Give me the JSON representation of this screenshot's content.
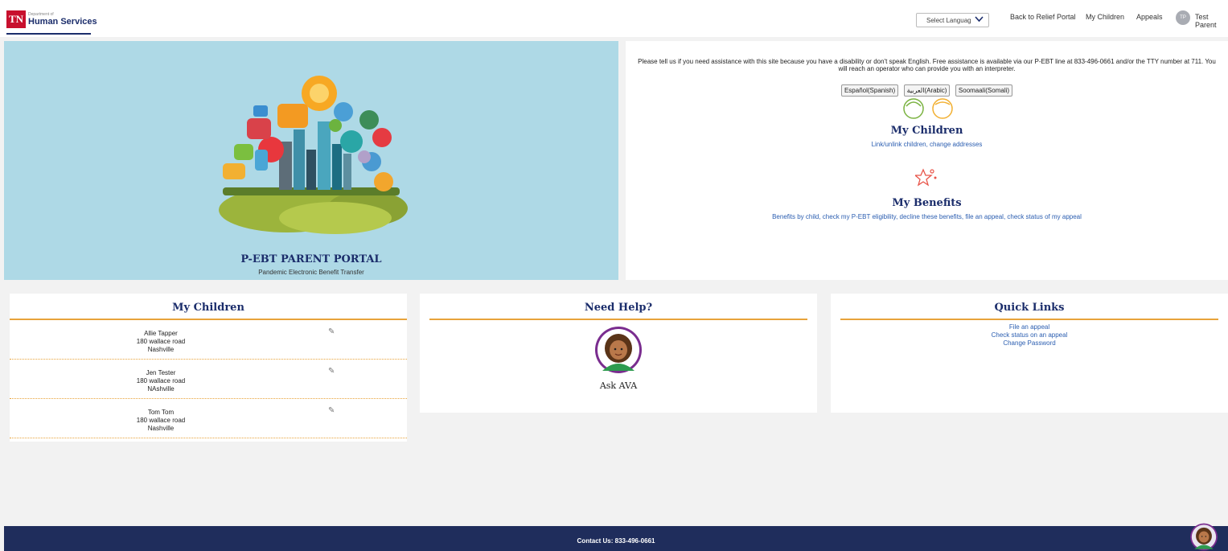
{
  "header": {
    "logo_abbr": "TN",
    "logo_dept": "Department of",
    "logo_name": "Human Services",
    "language_select": "Select Languag",
    "nav": {
      "back": "Back to Relief Portal",
      "children": "My Children",
      "appeals": "Appeals"
    },
    "user_initials": "TP",
    "user_name": "Test Parent"
  },
  "hero": {
    "title": "P-EBT PARENT PORTAL",
    "subtitle": "Pandemic Electronic Benefit Transfer"
  },
  "assistance": {
    "text": "Please tell us if you need assistance with this site because you have a disability or don't speak English. Free assistance is available via our P-EBT line at 833-496-0661 and/or the TTY number at 711. You will reach an operator who can provide you with an interpreter.",
    "languages": [
      "Español(Spanish)",
      "العربية(Arabic)",
      "Soomaali(Somali)"
    ]
  },
  "sections": {
    "children": {
      "title": "My Children",
      "link": "Link/unlink children, change addresses"
    },
    "benefits": {
      "title": "My Benefits",
      "link": "Benefits by child, check my P-EBT eligibility, decline these benefits, file an appeal, check status of my appeal"
    }
  },
  "children_card": {
    "title": "My Children",
    "children": [
      {
        "name": "Allie Tapper",
        "street": "180 wallace road",
        "city": "Nashville"
      },
      {
        "name": "Jen Tester",
        "street": "180 wallace road",
        "city": "NAshville"
      },
      {
        "name": "Tom Tom",
        "street": "180 wallace road",
        "city": "Nashville"
      }
    ]
  },
  "help_card": {
    "title": "Need Help?",
    "label": "Ask AVA"
  },
  "links_card": {
    "title": "Quick Links",
    "links": [
      "File an appeal",
      "Check status on an appeal",
      "Change Password"
    ]
  },
  "footer": {
    "contact": "Contact Us: 833-496-0661"
  },
  "colors": {
    "navy": "#1b2d6b",
    "accent": "#e8a33a",
    "link": "#2a5db0",
    "hero_bg": "#aed9e6"
  }
}
